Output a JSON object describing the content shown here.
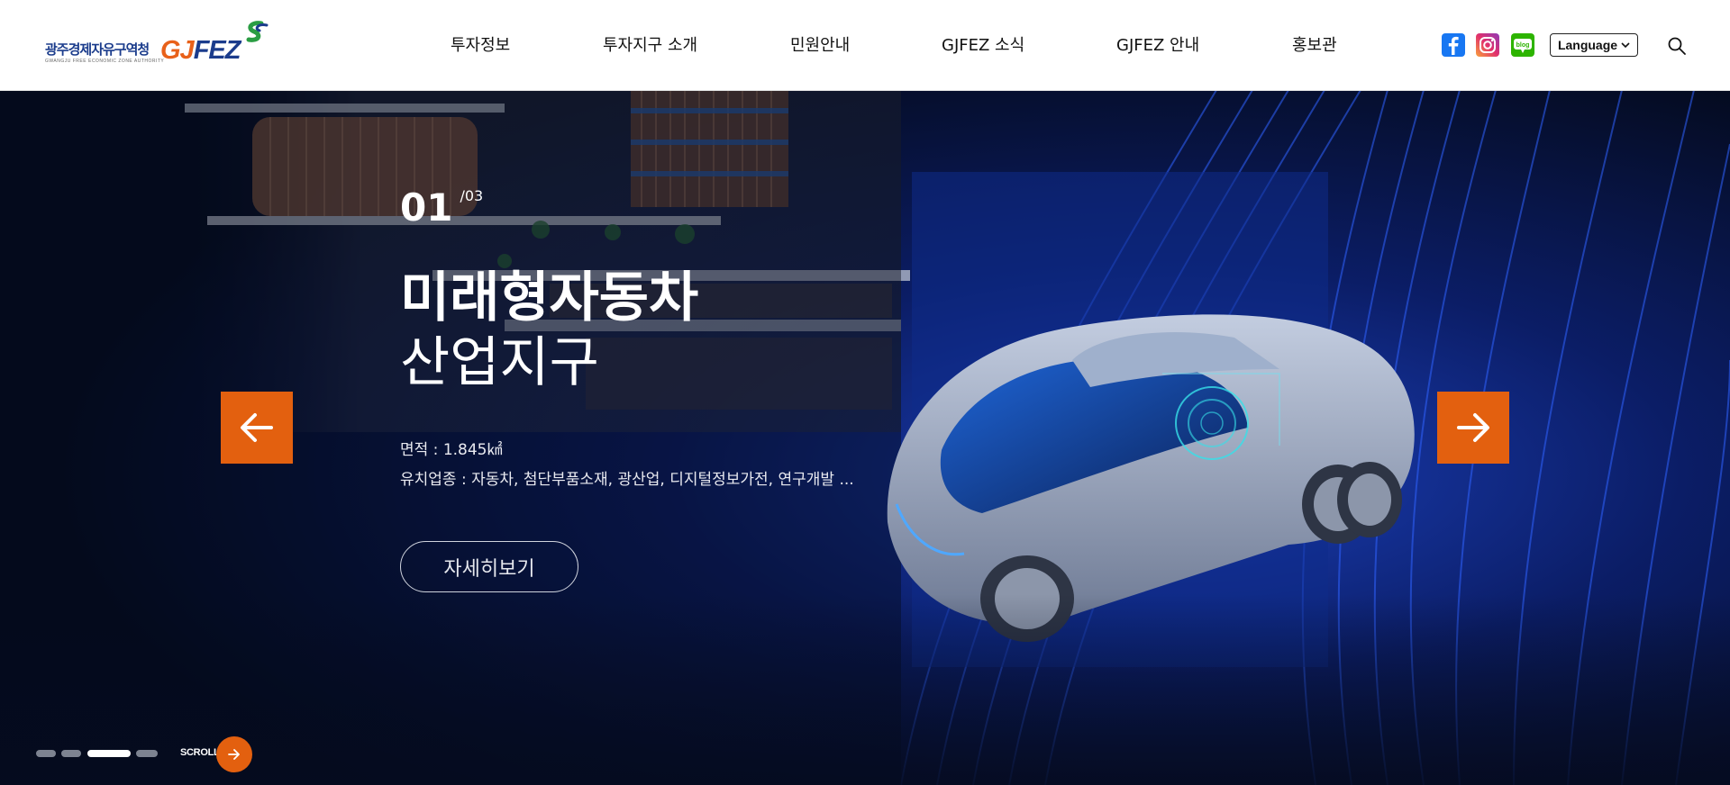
{
  "header": {
    "logo": {
      "kr_name": "광주경제자유구역청",
      "en_name": "GWANGJU FREE ECONOMIC ZONE AUTHORITY",
      "brand_gj": "GJ",
      "brand_fez": "FEZ"
    },
    "nav": [
      {
        "label": "투자정보"
      },
      {
        "label": "투자지구 소개"
      },
      {
        "label": "민원안내"
      },
      {
        "label": "GJFEZ 소식"
      },
      {
        "label": "GJFEZ 안내"
      },
      {
        "label": "홍보관"
      }
    ],
    "sns": {
      "blog_label": "blog"
    },
    "language_label": "Language"
  },
  "hero": {
    "counter": {
      "current": "01",
      "total": "/03"
    },
    "title_line1": "미래형자동차",
    "title_line2": "산업지구",
    "area": "면적 : 1.845㎢",
    "industries": "유치업종 : 자동차, 첨단부품소재, 광산업, 디지털정보가전, 연구개발 ...",
    "more_label": "자세히보기",
    "scroll_label": "SCROLL",
    "pagination": {
      "count": 4,
      "active_index": 2
    }
  },
  "colors": {
    "accent": "#e3600f",
    "brand_blue": "#1b3c8c",
    "hero_bg": "#050b1f"
  }
}
